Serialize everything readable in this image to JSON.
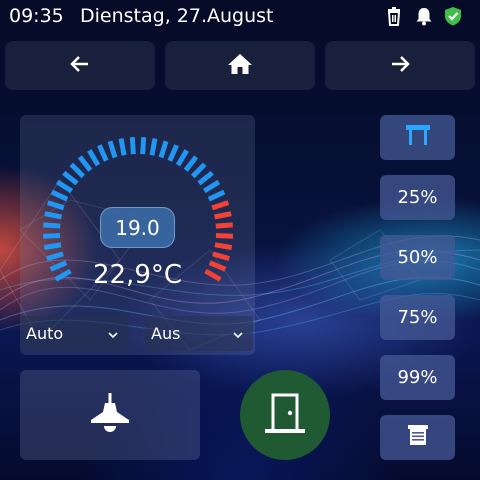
{
  "status_bar": {
    "time": "09:35",
    "date": "Dienstag, 27.August",
    "icons": [
      "trash-icon",
      "bell-icon",
      "shield-check-icon"
    ]
  },
  "nav": {
    "back_icon": "arrow-left-icon",
    "home_icon": "home-icon",
    "forward_icon": "arrow-right-icon"
  },
  "thermostat": {
    "setpoint": "19.0",
    "current_temperature": "22,9°C",
    "mode_select": "Auto",
    "fan_select": "Aus",
    "colors": {
      "cool": "#2196f3",
      "heat": "#f44336"
    }
  },
  "light": {
    "icon": "ceiling-lamp-icon"
  },
  "door": {
    "icon": "door-open-icon",
    "color": "#1f5a33"
  },
  "shutters": {
    "open_icon": "shutter-open-icon",
    "positions": [
      "25%",
      "50%",
      "75%",
      "99%"
    ],
    "close_icon": "shutter-closed-icon"
  }
}
